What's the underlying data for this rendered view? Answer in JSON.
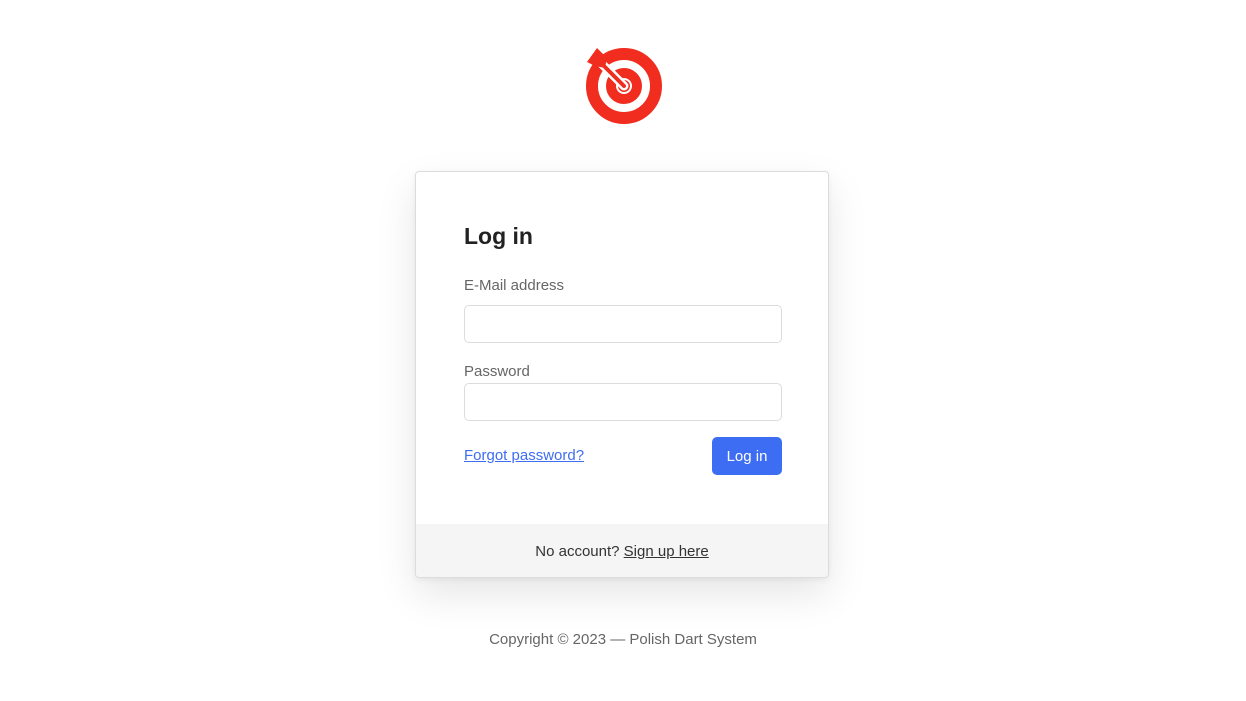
{
  "brand": {
    "logo_icon": "dart-target-icon",
    "logo_color": "#f02d1e"
  },
  "login": {
    "title": "Log in",
    "email_label": "E-Mail address",
    "email_value": "",
    "password_label": "Password",
    "password_value": "",
    "forgot_link": "Forgot password?",
    "submit_label": "Log in"
  },
  "footer_card": {
    "prompt": "No account?",
    "signup_link": "Sign up here"
  },
  "copyright": "Copyright © 2023 — Polish Dart System",
  "colors": {
    "accent": "#3d6df2",
    "footer_bg": "#f5f5f5",
    "border": "#dcdcdc"
  }
}
